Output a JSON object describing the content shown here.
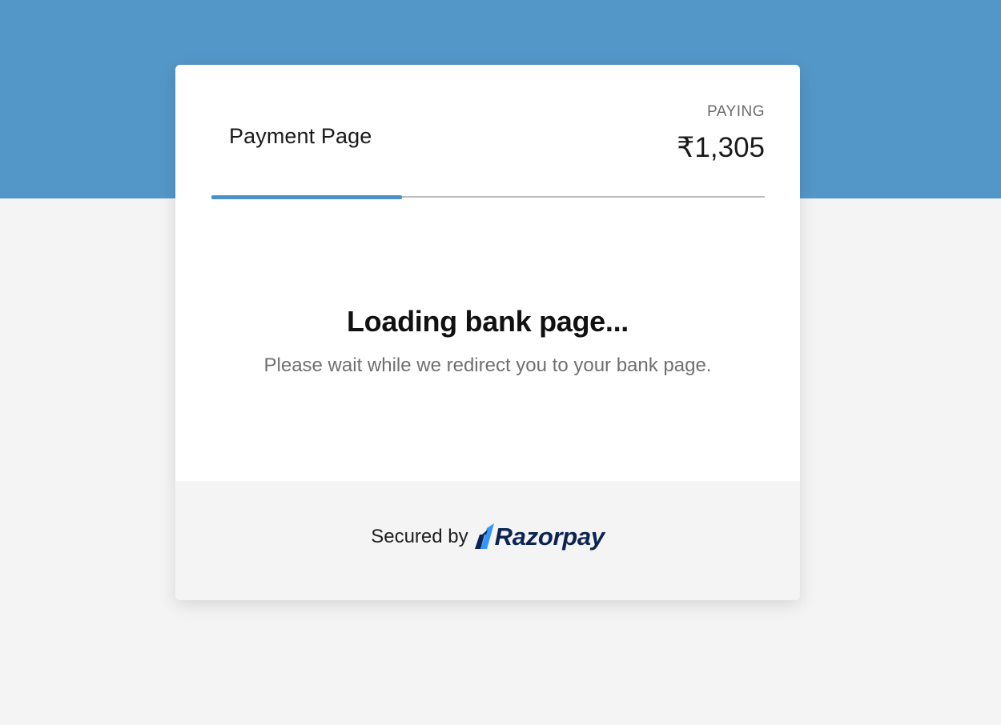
{
  "header": {
    "merchant_name": "Payment Page",
    "paying_label": "PAYING",
    "amount": "₹1,305"
  },
  "progress": {
    "fraction": 0.345
  },
  "status": {
    "title": "Loading bank page...",
    "message": "Please wait while we redirect you to your bank page."
  },
  "footer": {
    "secured_by": "Secured by",
    "brand": "Razorpay",
    "brand_icon": "razorpay-logo-icon"
  },
  "colors": {
    "top_band": "#5397c8",
    "progress_fill": "#4a90c9",
    "brand_dark": "#0c2451",
    "brand_light": "#3395ff"
  }
}
